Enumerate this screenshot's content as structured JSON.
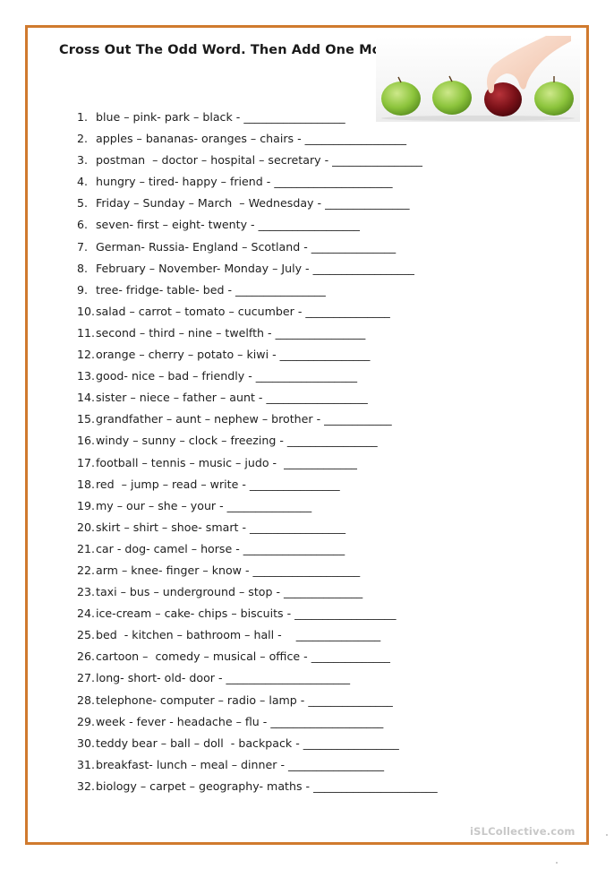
{
  "worksheet": {
    "title": "Cross Out The Odd Word. Then Add One More.",
    "image_alt": "four apples, a hand picking the red one",
    "watermark": "iSLCollective.com",
    "border_color": "#d07a2e",
    "items": [
      {
        "num": "1.",
        "words": "blue – pink- park – black - ",
        "blank": "__________________"
      },
      {
        "num": "2.",
        "words": "apples – bananas- oranges – chairs - ",
        "blank": "__________________"
      },
      {
        "num": "3.",
        "words": "postman  – doctor – hospital – secretary - ",
        "blank": "________________"
      },
      {
        "num": "4.",
        "words": "hungry – tired- happy – friend - ",
        "blank": "_____________________"
      },
      {
        "num": "5.",
        "words": "Friday – Sunday – March  – Wednesday - ",
        "blank": "_______________"
      },
      {
        "num": "6.",
        "words": "seven- first – eight- twenty - ",
        "blank": "__________________"
      },
      {
        "num": "7.",
        "words": "German- Russia- England – Scotland - ",
        "blank": "_______________"
      },
      {
        "num": "8.",
        "words": "February – November- Monday – July - ",
        "blank": "__________________"
      },
      {
        "num": "9.",
        "words": "tree- fridge- table- bed - ",
        "blank": "________________"
      },
      {
        "num": "10.",
        "words": "salad – carrot – tomato – cucumber - ",
        "blank": "_______________"
      },
      {
        "num": "11.",
        "words": "second – third – nine – twelfth - ",
        "blank": "________________"
      },
      {
        "num": "12.",
        "words": "orange – cherry – potato – kiwi - ",
        "blank": "________________"
      },
      {
        "num": "13.",
        "words": "good- nice – bad – friendly - ",
        "blank": "__________________"
      },
      {
        "num": "14.",
        "words": "sister – niece – father – aunt - ",
        "blank": "__________________"
      },
      {
        "num": "15.",
        "words": "grandfather – aunt – nephew – brother - ",
        "blank": "____________"
      },
      {
        "num": "16.",
        "words": "windy – sunny – clock – freezing - ",
        "blank": "________________"
      },
      {
        "num": "17.",
        "words": "football – tennis – music – judo -  ",
        "blank": "_____________"
      },
      {
        "num": "18.",
        "words": "red  – jump – read – write - ",
        "blank": "________________"
      },
      {
        "num": "19.",
        "words": "my – our – she – your - ",
        "blank": "_______________"
      },
      {
        "num": "20.",
        "words": "skirt – shirt – shoe- smart - ",
        "blank": "_________________"
      },
      {
        "num": "21.",
        "words": "car - dog- camel – horse - ",
        "blank": "__________________"
      },
      {
        "num": "22.",
        "words": "arm – knee- finger – know - ",
        "blank": "___________________"
      },
      {
        "num": "23.",
        "words": "taxi – bus – underground – stop - ",
        "blank": "______________"
      },
      {
        "num": "24.",
        "words": "ice-cream – cake- chips – biscuits - ",
        "blank": "__________________"
      },
      {
        "num": "25.",
        "words": "bed  - kitchen – bathroom – hall -    ",
        "blank": "_______________"
      },
      {
        "num": "26.",
        "words": "cartoon –  comedy – musical – office - ",
        "blank": "______________"
      },
      {
        "num": "27.",
        "words": "long- short- old- door - ",
        "blank": "______________________"
      },
      {
        "num": "28.",
        "words": "telephone- computer – radio – lamp - ",
        "blank": "_______________"
      },
      {
        "num": "29.",
        "words": "week - fever - headache – flu - ",
        "blank": "____________________"
      },
      {
        "num": "30.",
        "words": "teddy bear – ball – doll  - backpack - ",
        "blank": "_________________"
      },
      {
        "num": "31.",
        "words": "breakfast- lunch – meal – dinner - ",
        "blank": "_________________"
      },
      {
        "num": "32.",
        "words": "biology – carpet – geography- maths - ",
        "blank": "______________________"
      }
    ]
  }
}
